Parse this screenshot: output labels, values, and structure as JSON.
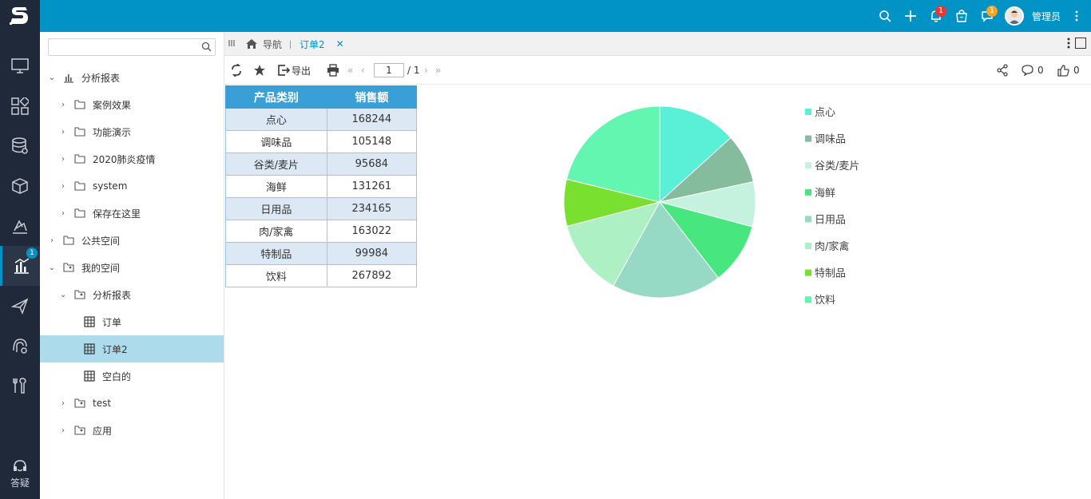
{
  "header": {
    "user_name": "管理员",
    "notification_count": "1",
    "message_count": "1",
    "colors": {
      "bar": "#0193c6",
      "rail": "#202939"
    }
  },
  "rail": {
    "analysis_badge": "1",
    "help_label": "答疑",
    "items": [
      "monitor-icon",
      "dashboard-icon",
      "data-source-icon",
      "cube-icon",
      "model-icon",
      "analysis-icon",
      "send-icon",
      "permission-icon",
      "tools-icon"
    ]
  },
  "tree": {
    "search_placeholder": "",
    "nodes": [
      {
        "label": "分析报表"
      },
      {
        "label": "案例效果"
      },
      {
        "label": "功能演示"
      },
      {
        "label": "2020肺炎疫情"
      },
      {
        "label": "system"
      },
      {
        "label": "保存在这里"
      },
      {
        "label": "公共空间"
      },
      {
        "label": "我的空间"
      },
      {
        "label": "分析报表"
      },
      {
        "label": "订单"
      },
      {
        "label": "订单2"
      },
      {
        "label": "空白的"
      },
      {
        "label": "test"
      },
      {
        "label": "应用"
      }
    ]
  },
  "tabs": {
    "home_label": "导航",
    "active_label": "订单2"
  },
  "toolbar": {
    "export_label": "导出",
    "page_value": "1",
    "page_total": "/ 1",
    "comments": "0",
    "likes": "0"
  },
  "table": {
    "headers": [
      "产品类别",
      "销售额"
    ],
    "rows": [
      [
        "点心",
        "168244"
      ],
      [
        "调味品",
        "105148"
      ],
      [
        "谷类/麦片",
        "95684"
      ],
      [
        "海鲜",
        "131261"
      ],
      [
        "日用品",
        "234165"
      ],
      [
        "肉/家禽",
        "163022"
      ],
      [
        "特制品",
        "99984"
      ],
      [
        "饮料",
        "267892"
      ]
    ]
  },
  "chart_data": {
    "type": "pie",
    "categories": [
      "点心",
      "调味品",
      "谷类/麦片",
      "海鲜",
      "日用品",
      "肉/家禽",
      "特制品",
      "饮料"
    ],
    "values": [
      168244,
      105148,
      95684,
      131261,
      234165,
      163022,
      99984,
      267892
    ],
    "colors": [
      "#5af0d8",
      "#86bc9e",
      "#c5f2df",
      "#47e67f",
      "#96d9c4",
      "#adf0c3",
      "#79e02f",
      "#62f6b0"
    ],
    "legend_position": "right",
    "start_angle": "top, clockwise"
  }
}
